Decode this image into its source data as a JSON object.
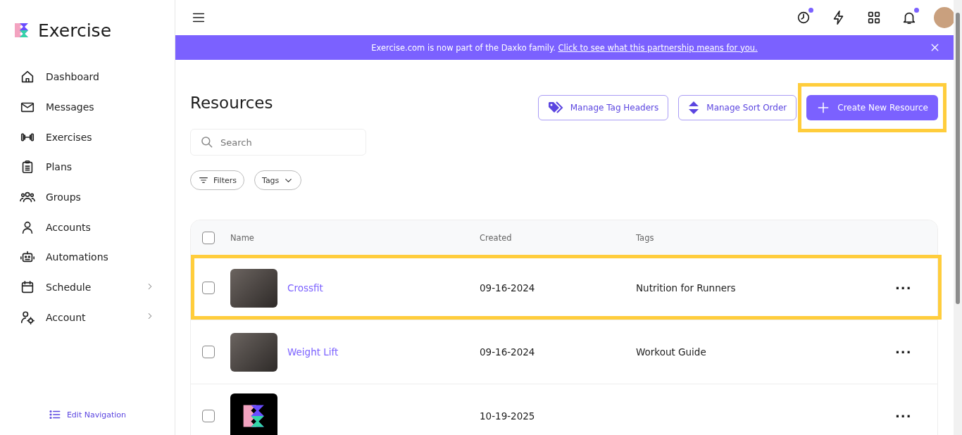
{
  "brand": {
    "name": "Exercise"
  },
  "sidebar": {
    "items": [
      {
        "label": "Dashboard",
        "has_submenu": false
      },
      {
        "label": "Messages",
        "has_submenu": false
      },
      {
        "label": "Exercises",
        "has_submenu": false
      },
      {
        "label": "Plans",
        "has_submenu": false
      },
      {
        "label": "Groups",
        "has_submenu": false
      },
      {
        "label": "Accounts",
        "has_submenu": false
      },
      {
        "label": "Automations",
        "has_submenu": false
      },
      {
        "label": "Schedule",
        "has_submenu": true
      },
      {
        "label": "Account",
        "has_submenu": true
      }
    ],
    "footer_link": "Edit Navigation"
  },
  "topbar": {
    "icons": [
      {
        "badge": true
      },
      {
        "badge": false
      },
      {
        "badge": false
      },
      {
        "badge": true
      }
    ]
  },
  "banner": {
    "text": "Exercise.com is now part of the Daxko family.",
    "link": "Click to see what this partnership means for you."
  },
  "page": {
    "title": "Resources",
    "buttons": [
      {
        "label": "Manage Tag Headers",
        "kind": "outline",
        "highlighted": false
      },
      {
        "label": "Manage Sort Order",
        "kind": "outline",
        "highlighted": false
      },
      {
        "label": "Create New Resource",
        "kind": "primary",
        "highlighted": true
      }
    ],
    "search": {
      "placeholder": "Search"
    },
    "filters": [
      {
        "label": "Filters",
        "kind": "filter"
      },
      {
        "label": "Tags",
        "kind": "dropdown"
      }
    ]
  },
  "table": {
    "select_all_checked": false,
    "columns": [
      "Name",
      "Created",
      "Tags"
    ],
    "rows": [
      {
        "name": "Crossfit",
        "created": "09-16-2024",
        "tags": "Nutrition for Runners",
        "kind": "photo",
        "actions": "···",
        "checked": false,
        "highlighted": true
      },
      {
        "name": "Weight Lift",
        "created": "09-16-2024",
        "tags": "Workout Guide",
        "kind": "photo",
        "actions": "···",
        "checked": false,
        "highlighted": false
      },
      {
        "created": "10-19-2025",
        "kind": "logo",
        "actions": "···",
        "checked": false,
        "highlighted": false
      }
    ]
  }
}
